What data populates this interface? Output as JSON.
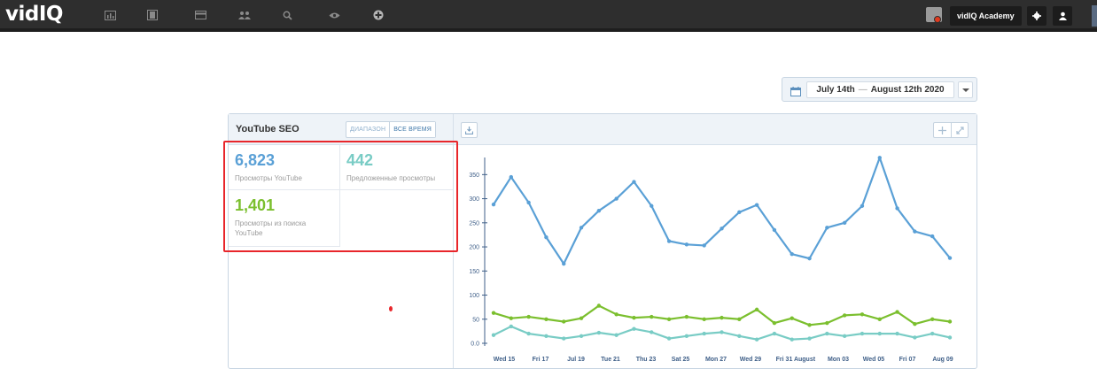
{
  "nav": {
    "logo_vid": "vid",
    "logo_iq": "IQ",
    "icons": [
      "dashboard-icon",
      "film-icon",
      "card-icon",
      "users-icon",
      "search-icon",
      "eye-icon",
      "plus-circle-icon"
    ],
    "academy_label": "vidIQ Academy",
    "settings_icon": "gear-icon",
    "user_icon": "user-icon"
  },
  "date_range": {
    "start": "July 14th",
    "separator": "—",
    "end": "August 12th 2020"
  },
  "widget": {
    "title": "YouTube SEO",
    "range_buttons": [
      "ДИАПАЗОН",
      "ВСЕ ВРЕМЯ"
    ],
    "stats": [
      {
        "value": "6,823",
        "label": "Просмотры YouTube",
        "color": "#5aa0d6"
      },
      {
        "value": "442",
        "label": "Предложенные просмотры",
        "color": "#79ccc5"
      },
      {
        "value": "1,401",
        "label": "Просмотры из поиска YouTube",
        "color": "#7bbf2e"
      }
    ]
  },
  "chart_data": {
    "type": "line",
    "x_labels": [
      "Wed 15",
      "Fri 17",
      "Jul 19",
      "Tue 21",
      "Thu 23",
      "Sat 25",
      "Mon 27",
      "Wed 29",
      "Fri 31",
      "August",
      "Mon 03",
      "Wed 05",
      "Fri 07",
      "Aug 09"
    ],
    "y_ticks": [
      "350",
      "300",
      "250",
      "200",
      "150",
      "100",
      "50",
      "0.0"
    ],
    "ylim": [
      0,
      380
    ],
    "grid": false,
    "series": [
      {
        "color": "#5aa0d6",
        "values": [
          288,
          345,
          292,
          220,
          165,
          240,
          275,
          300,
          335,
          285,
          212,
          205,
          203,
          238,
          272,
          287,
          235,
          185,
          176,
          240,
          250,
          285,
          385,
          280,
          232,
          222,
          177
        ]
      },
      {
        "color": "#7bbf2e",
        "values": [
          63,
          52,
          55,
          50,
          45,
          52,
          78,
          60,
          53,
          55,
          50,
          55,
          50,
          53,
          50,
          70,
          42,
          52,
          38,
          42,
          58,
          60,
          50,
          65,
          40,
          50,
          45
        ]
      },
      {
        "color": "#79ccc5",
        "values": [
          17,
          35,
          20,
          15,
          10,
          15,
          22,
          17,
          30,
          23,
          10,
          15,
          20,
          23,
          15,
          8,
          20,
          8,
          10,
          20,
          15,
          20,
          20,
          20,
          12,
          20,
          12
        ]
      }
    ]
  }
}
